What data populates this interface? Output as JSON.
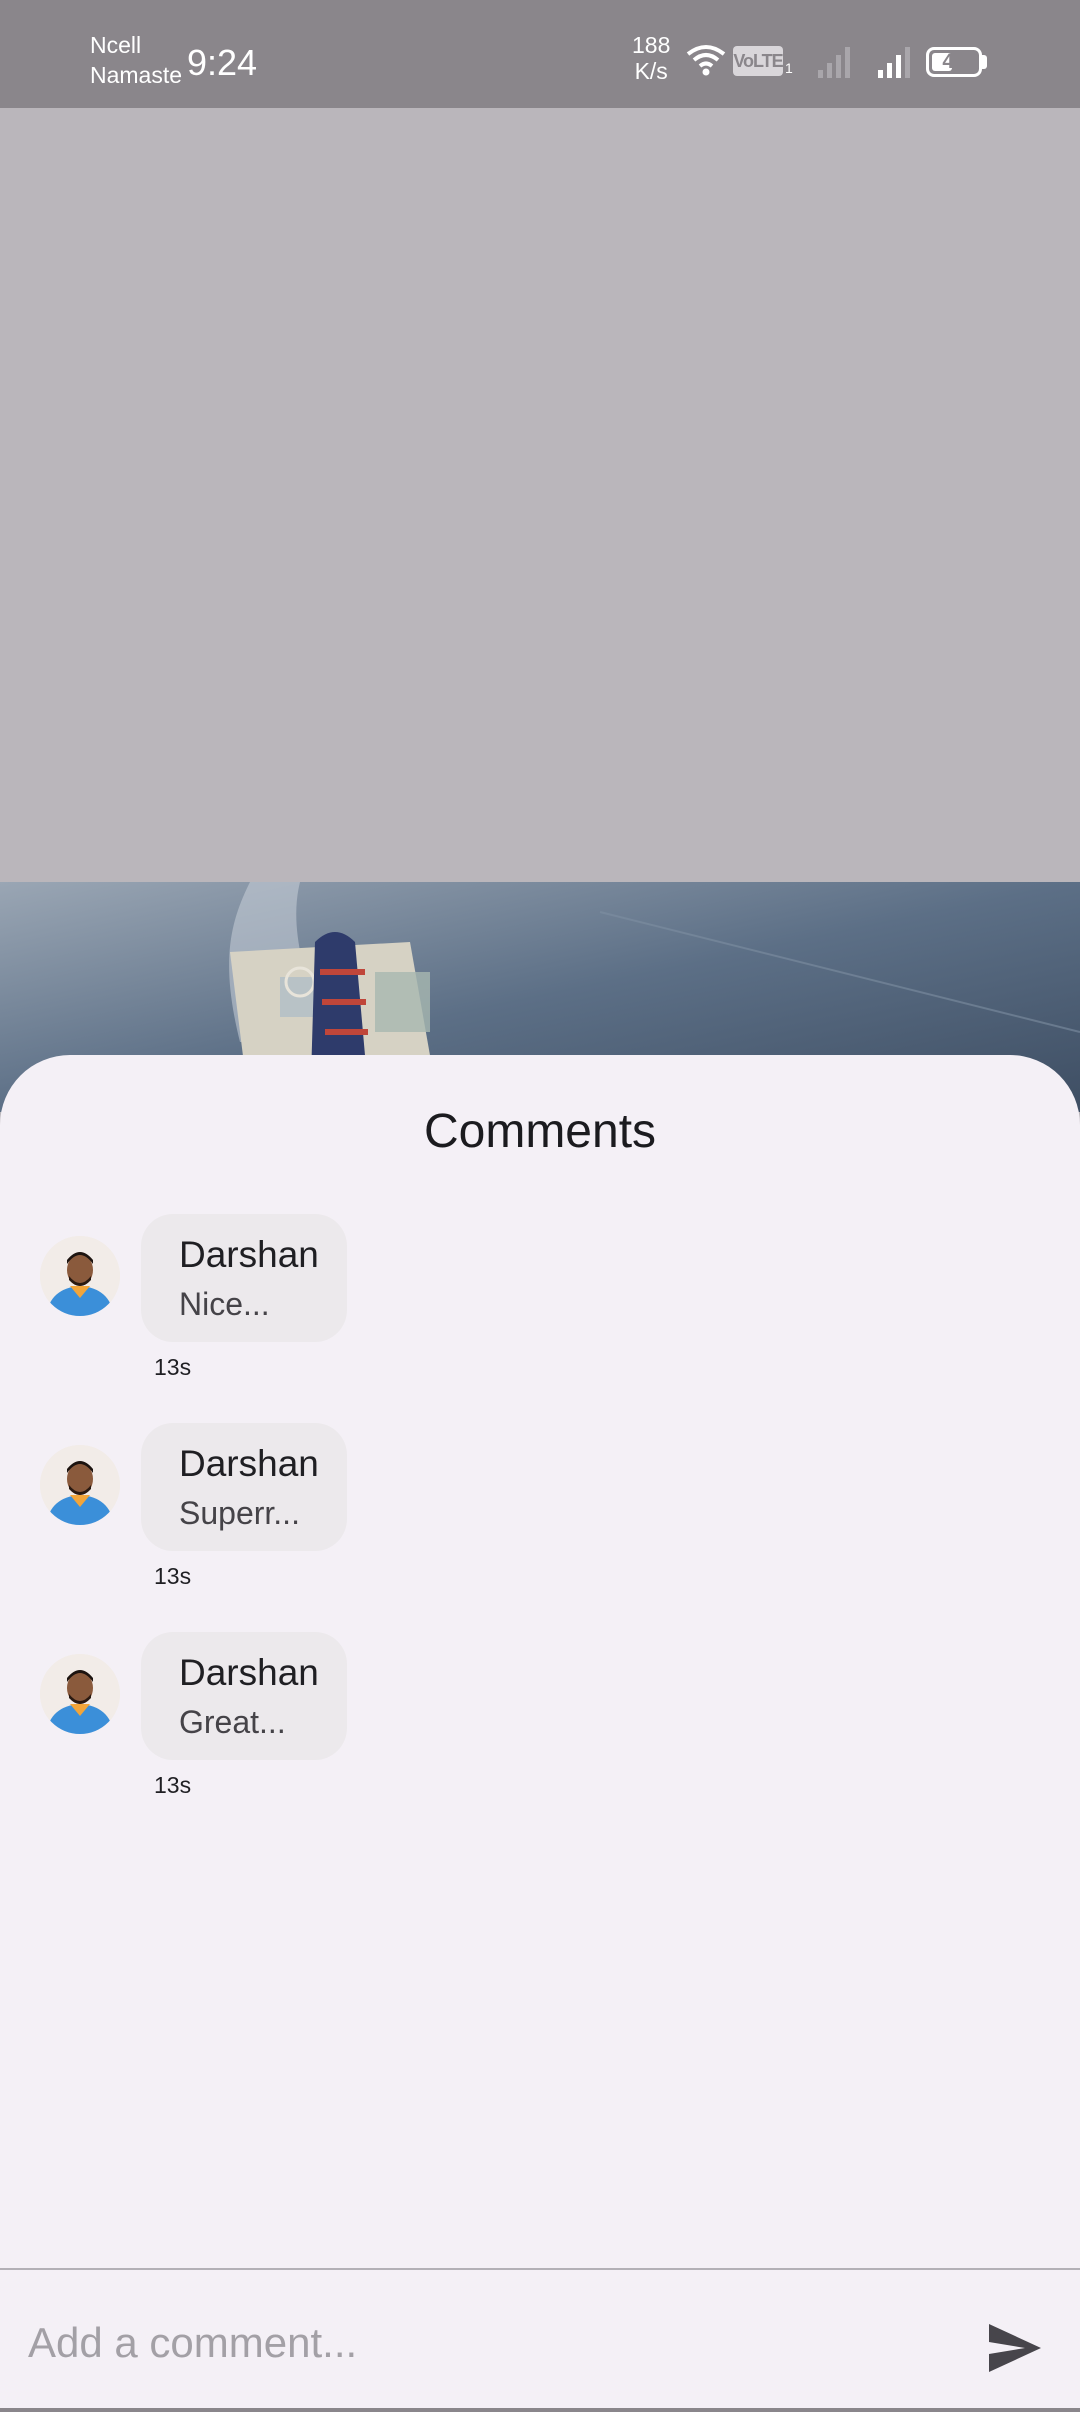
{
  "status_bar": {
    "carrier_line1": "Ncell",
    "carrier_line2": "Namaste",
    "time": "9:24",
    "net_speed_value": "188",
    "net_speed_unit": "K/s",
    "volte_label": "VoLTE",
    "sim_label": "1",
    "battery_level": "45",
    "battery_fraction": 0.45
  },
  "sheet": {
    "title": "Comments"
  },
  "comments": [
    {
      "author": "Darshan",
      "text": "Nice...",
      "time": "13s"
    },
    {
      "author": "Darshan",
      "text": "Superr...",
      "time": "13s"
    },
    {
      "author": "Darshan",
      "text": "Great...",
      "time": "13s"
    }
  ],
  "composer": {
    "placeholder": "Add a comment...",
    "send_icon": "send-icon"
  },
  "colors": {
    "sheet_background": "#f4f0f6",
    "bubble_background": "#ece9ec",
    "status_bar": "#8a868b"
  }
}
